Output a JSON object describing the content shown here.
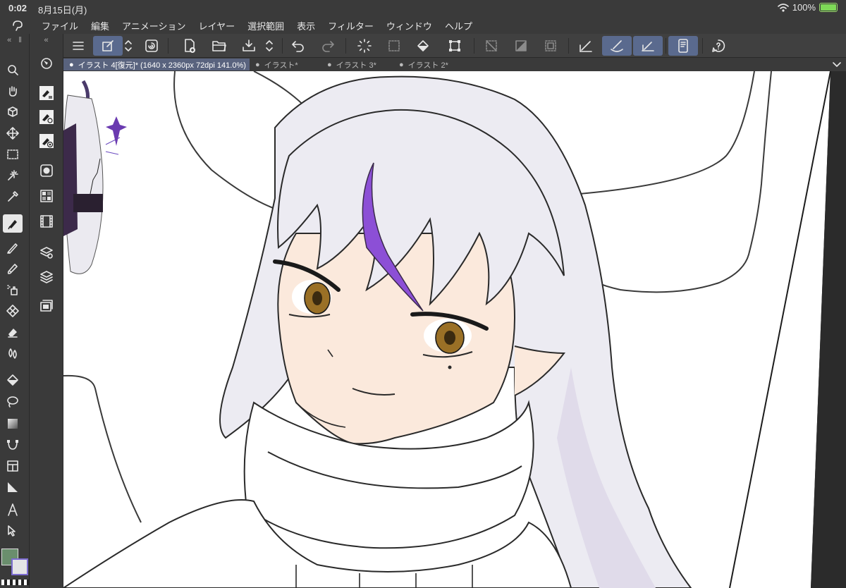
{
  "status_bar": {
    "time": "0:02",
    "date": "8月15日(月)",
    "battery": "100%"
  },
  "menu": [
    "ファイル",
    "編集",
    "アニメーション",
    "レイヤー",
    "選択範囲",
    "表示",
    "フィルター",
    "ウィンドウ",
    "ヘルプ"
  ],
  "tabs": [
    {
      "label": "イラスト 4[復元]* (1640 x 2360px 72dpi 141.0%)",
      "active": true
    },
    {
      "label": "イラスト*",
      "active": false
    },
    {
      "label": "イラスト 3*",
      "active": false
    },
    {
      "label": "イラスト 2*",
      "active": false
    }
  ],
  "toolbar": {
    "column_collapse_glyph": "«",
    "column_split_glyph": "‖",
    "tab_bullet": "●"
  },
  "colors": {
    "main_color": "#6a8e6d",
    "sub_color": "#e4e4e6",
    "accent": "#5a6a8e",
    "hair_streak": "#8c4fd6"
  },
  "icons": {
    "tools": [
      "zoom-icon",
      "hand-icon",
      "rotate-3d-icon",
      "move-icon",
      "selection-icon",
      "auto-select-icon",
      "eyedropper-icon",
      "pen-icon",
      "pencil-icon",
      "brush-icon",
      "airbrush-icon",
      "decoration-icon",
      "eraser-icon",
      "blend-icon",
      "fill-icon",
      "lasso-fill-icon",
      "gradient-icon",
      "figure-icon",
      "frame-icon",
      "ruler-icon",
      "text-icon",
      "operation-icon"
    ],
    "sub_panels": [
      "navigator-icon",
      "sub-tool-icon",
      "tool-property-icon",
      "brush-size-icon",
      "color-wheel-icon",
      "color-set-icon",
      "timeline-icon",
      "layer-property-icon",
      "layer-icon",
      "material-icon"
    ]
  }
}
